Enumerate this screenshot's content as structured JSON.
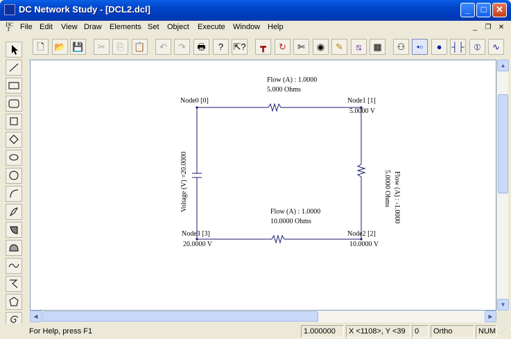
{
  "window": {
    "title": "DC Network Study - [DCL2.dcl]"
  },
  "menu": {
    "items": [
      "File",
      "Edit",
      "View",
      "Draw",
      "Elements",
      "Set",
      "Object",
      "Execute",
      "Window",
      "Help"
    ]
  },
  "diagram": {
    "nodes": [
      {
        "label": "Node0 [0]",
        "value": ""
      },
      {
        "label": "Node1 [1]",
        "value": "5.0000 V"
      },
      {
        "label": "Node2 [2]",
        "value": "10.0000 V"
      },
      {
        "label": "Node3 [3]",
        "value": "20.0000 V"
      }
    ],
    "branches": {
      "top": {
        "flow": "Flow (A) : 1.0000",
        "resistance": "5.000 Ohms"
      },
      "right": {
        "resistance": "5.0000 Ohms",
        "flow": "Flow (A) : -1.0000"
      },
      "bottom": {
        "flow": "Flow (A) : 1.0000",
        "resistance": "10.0000 Ohms"
      },
      "left": {
        "voltage": "Voltage (V) =20.0000"
      }
    }
  },
  "status": {
    "help": "For Help, press F1",
    "zoom": "1.000000",
    "coords": "X <1108>, Y <39",
    "value": "0",
    "ortho": "Ortho",
    "num": "NUM"
  },
  "colors": {
    "titlebar": "#0043c8",
    "wire": "#1a1a6e",
    "canvas": "#ffffff"
  }
}
